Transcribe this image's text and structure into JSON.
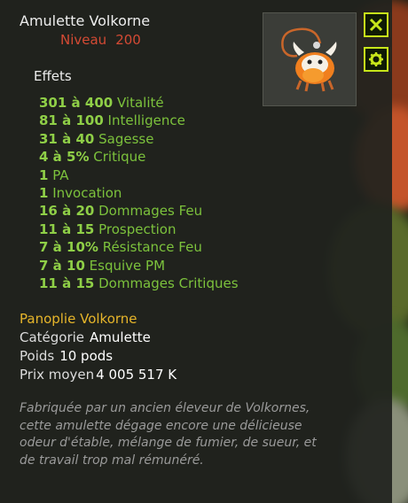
{
  "item": {
    "name": "Amulette Volkorne",
    "level_label": "Niveau",
    "level_value": "200",
    "icon": "orange-bull-amulet-icon"
  },
  "effects_title": "Effets",
  "effects": [
    {
      "value": "301 à 400",
      "stat": "Vitalité"
    },
    {
      "value": "81 à 100",
      "stat": "Intelligence"
    },
    {
      "value": "31 à 40",
      "stat": "Sagesse"
    },
    {
      "value": "4 à 5%",
      "stat": "Critique"
    },
    {
      "value": "1",
      "stat": "PA"
    },
    {
      "value": "1",
      "stat": "Invocation"
    },
    {
      "value": "16 à 20",
      "stat": "Dommages Feu"
    },
    {
      "value": "11 à 15",
      "stat": "Prospection"
    },
    {
      "value": "7 à 10%",
      "stat": "Résistance Feu"
    },
    {
      "value": "7 à 10",
      "stat": "Esquive PM"
    },
    {
      "value": "11 à 15",
      "stat": "Dommages Critiques"
    }
  ],
  "set_name": "Panoplie Volkorne",
  "category": {
    "label": "Catégorie",
    "value": "Amulette"
  },
  "weight": {
    "label": "Poids",
    "value": "10 pods"
  },
  "price": {
    "label": "Prix moyen",
    "value": "4 005 517 K"
  },
  "description": "Fabriquée par un ancien éleveur de Volkornes, cette amulette dégage encore une délicieuse odeur d'étable, mélange de fumier, de sueur, et de travail trop mal rémunéré.",
  "buttons": {
    "close_icon": "close-icon",
    "settings_icon": "gear-icon"
  },
  "colors": {
    "effect_green": "#7cc23c",
    "level_red": "#d44a34",
    "set_gold": "#e6b52a",
    "button_lime": "#c7e61a"
  }
}
